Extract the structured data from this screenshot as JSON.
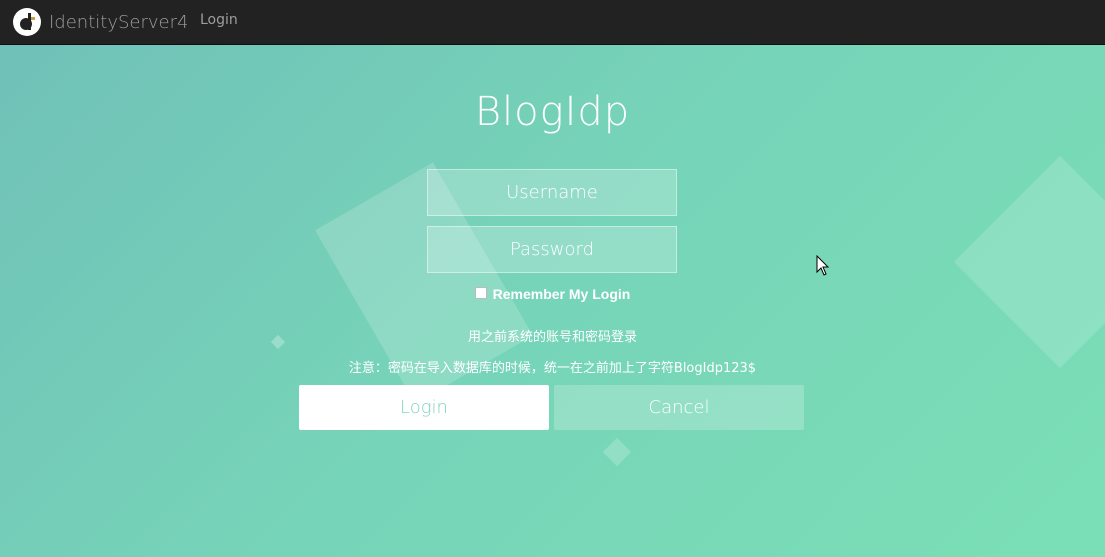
{
  "navbar": {
    "brand": "IdentityServer4",
    "login_link": "Login"
  },
  "login_panel": {
    "title": "BlogIdp",
    "username_placeholder": "Username",
    "password_placeholder": "Password",
    "remember_label": "Remember My Login",
    "note_line1": "用之前系统的账号和密码登录",
    "note_line2": "注意：密码在导入数据库的时候，统一在之前加上了字符BlogIdp123$",
    "login_button": "Login",
    "cancel_button": "Cancel"
  },
  "colors": {
    "navbar_bg": "#222222",
    "accent": "#76d3b8",
    "login_text": "#7fd6bf"
  },
  "icons": {
    "brand": "identityserver-logo-icon",
    "checkbox": "checkbox-icon",
    "cursor": "mouse-pointer-icon"
  }
}
